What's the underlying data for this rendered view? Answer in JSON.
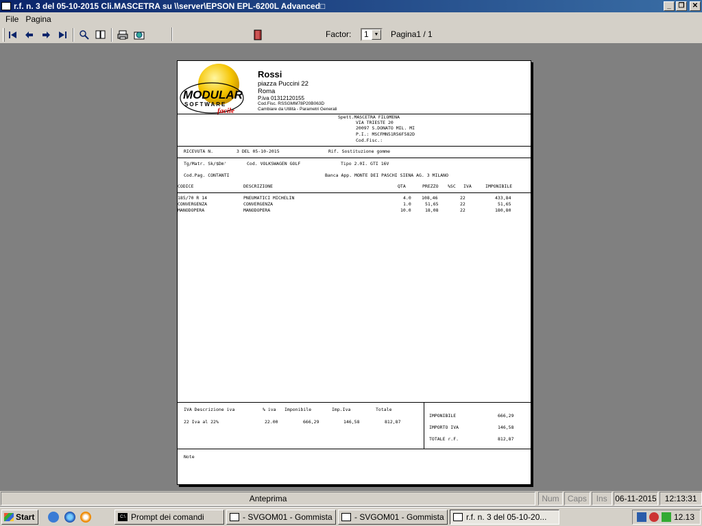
{
  "window": {
    "title": "r.f. n.   3 del 05-10-2015 Cli.MASCETRA su \\\\server\\EPSON EPL-6200L Advanced□"
  },
  "menu": [
    "File",
    "Pagina"
  ],
  "toolbar": {
    "factor_label": "Factor:",
    "factor_value": "1",
    "pagina_label": "Pagina1 / 1"
  },
  "document": {
    "logo_text": "MODULAR",
    "logo_sub": "SOFTWARE",
    "logo_script": "facile",
    "company": {
      "name": "Rossi",
      "address": "piazza Puccini 22",
      "city": "Roma",
      "piva": "P.iva 01312120155",
      "codfisc": "Cod.Fisc. RSSGMM78P20B063D",
      "note": "Cambiare da Utilità - Parametri Generali"
    },
    "customer": {
      "line1": "Spett.MASCETRA FILOMENA",
      "line2": "VIA TRIESTE 20",
      "line3": "20097 S.DONATO MIL. MI",
      "line4": "P.I.: MSCFMN51R56F582D",
      "line5": "Cod.Fisc.:"
    },
    "receipt": {
      "label": "RICEVUTA N.",
      "number": "3 DEL 05-10-2015",
      "rif": "Rif. Sostituzione gomme"
    },
    "vehicle": {
      "targa": "Tg/Matr. Sk/$Dm'",
      "cod": "Cod. VOLKSWAGEN GOLF",
      "tipo": "Tipo 2.0I. GTI 16V"
    },
    "payment": {
      "codpag": "Cod.Pag. CONTANTI",
      "banca": "Banca App. MONTE DEI PASCHI SIENA   AG. 3   MILANO"
    },
    "table_headers": [
      "CODICE",
      "DESCRIZIONE",
      "QTA",
      "PREZZO",
      "%SC",
      "IVA",
      "IMPONIBILE"
    ],
    "rows": [
      {
        "codice": "185/70 R  14",
        "descrizione": "PNEUMATICI MICHELIN",
        "qta": "4.0",
        "prezzo": "108,46",
        "sc": "",
        "iva": "22",
        "imponibile": "433,84"
      },
      {
        "codice": "CONVERGENZA",
        "descrizione": "CONVERGENZA",
        "qta": "1.0",
        "prezzo": "51,65",
        "sc": "",
        "iva": "22",
        "imponibile": "51,65"
      },
      {
        "codice": "MANODOPERA",
        "descrizione": "MANODOPERA",
        "qta": "10.0",
        "prezzo": "18,08",
        "sc": "",
        "iva": "22",
        "imponibile": "180,80"
      }
    ],
    "iva_headers": [
      "IVA Descrizione iva",
      "% iva",
      "Imponibile",
      "Imp.Iva",
      "Totale"
    ],
    "iva_row": {
      "code_desc": "22  Iva al 22%",
      "perc": "22.00",
      "imponibile": "666,29",
      "impiva": "146,58",
      "totale": "812,87"
    },
    "totals": [
      {
        "label": "IMPONIBILE",
        "value": "666,29"
      },
      {
        "label": "IMPORTO IVA",
        "value": "146,58"
      },
      {
        "label": "TOTALE r.F.",
        "value": "812,87"
      }
    ],
    "note_label": "Note"
  },
  "statusbar": {
    "main": "Anteprima",
    "num": "Num",
    "caps": "Caps",
    "ins": "Ins",
    "date": "06-11-2015",
    "time": "12:13:31"
  },
  "taskbar": {
    "start": "Start",
    "tasks": [
      "Prompt dei comandi",
      "- SVGOM01 - Gommista  ...",
      "- SVGOM01 - Gommista  ...",
      "r.f. n.  3 del 05-10-20..."
    ],
    "clock": "12.13"
  }
}
